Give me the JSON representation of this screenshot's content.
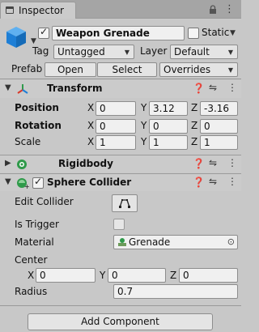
{
  "tab": {
    "title": "Inspector"
  },
  "object": {
    "name": "Weapon Grenade",
    "active": true,
    "static_label": "Static",
    "static_checked": false,
    "tag_label": "Tag",
    "tag_value": "Untagged",
    "layer_label": "Layer",
    "layer_value": "Default",
    "prefab_label": "Prefab",
    "open_label": "Open",
    "select_label": "Select",
    "overrides_label": "Overrides"
  },
  "transform": {
    "title": "Transform",
    "position_label": "Position",
    "rotation_label": "Rotation",
    "scale_label": "Scale",
    "x": "X",
    "y": "Y",
    "z": "Z",
    "position": [
      "0",
      "3.12",
      "-3.16"
    ],
    "rotation": [
      "0",
      "0",
      "0"
    ],
    "scale": [
      "1",
      "1",
      "1"
    ]
  },
  "rigidbody": {
    "title": "Rigidbody"
  },
  "sphere_collider": {
    "title": "Sphere Collider",
    "enabled": true,
    "edit_collider_label": "Edit Collider",
    "is_trigger_label": "Is Trigger",
    "is_trigger": false,
    "material_label": "Material",
    "material_value": "Grenade",
    "center_label": "Center",
    "center": [
      "0",
      "0",
      "0"
    ],
    "x": "X",
    "y": "Y",
    "z": "Z",
    "radius_label": "Radius",
    "radius_value": "0.7"
  },
  "footer": {
    "add_component_label": "Add Component"
  },
  "icons": {
    "help": "help-icon",
    "presets": "presets-icon",
    "menu": "kebab-menu-icon"
  },
  "colors": {
    "panel": "#c8c8c8",
    "header": "#cbcbcb",
    "cube_blue": "#1e7fd6",
    "transform_red": "#d93a2a",
    "rigid_green": "#2f9a4a"
  }
}
